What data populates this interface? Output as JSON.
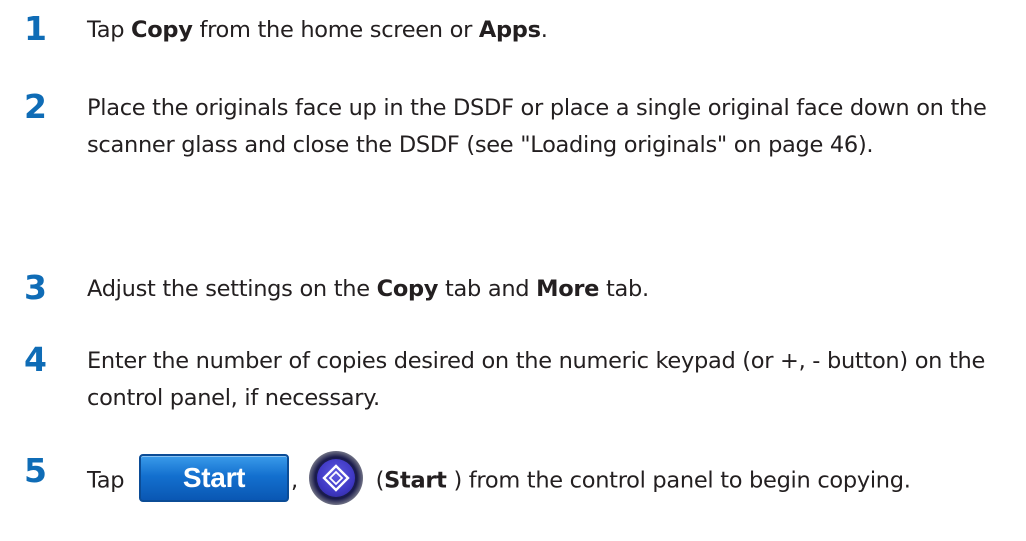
{
  "steps": [
    {
      "number": "1",
      "parts": {
        "a": "Tap ",
        "b": "Copy",
        "c": " from the home screen or ",
        "d": "Apps",
        "e": "."
      }
    },
    {
      "number": "2",
      "text": "Place the originals face up in the DSDF or place a single original face down on the scanner glass and close the DSDF (see \"Loading originals\" on page 46)."
    },
    {
      "number": "3",
      "parts": {
        "a": "Adjust the settings on the ",
        "b": "Copy",
        "c": " tab and ",
        "d": "More",
        "e": " tab."
      }
    },
    {
      "number": "4",
      "text": "Enter the number of copies desired on the numeric keypad (or +, - button) on the control panel, if necessary."
    },
    {
      "number": "5",
      "parts": {
        "a": "Tap ",
        "button_label": "Start",
        "b": ", ",
        "c": " (",
        "d": "Start",
        "e": " ) from the control panel to begin copying."
      }
    }
  ],
  "colors": {
    "step_number": "#0f6cb6",
    "start_button": "#1370cf",
    "start_key": "#3f38c4"
  },
  "icons": {
    "start_key": "start-diamond-icon"
  }
}
